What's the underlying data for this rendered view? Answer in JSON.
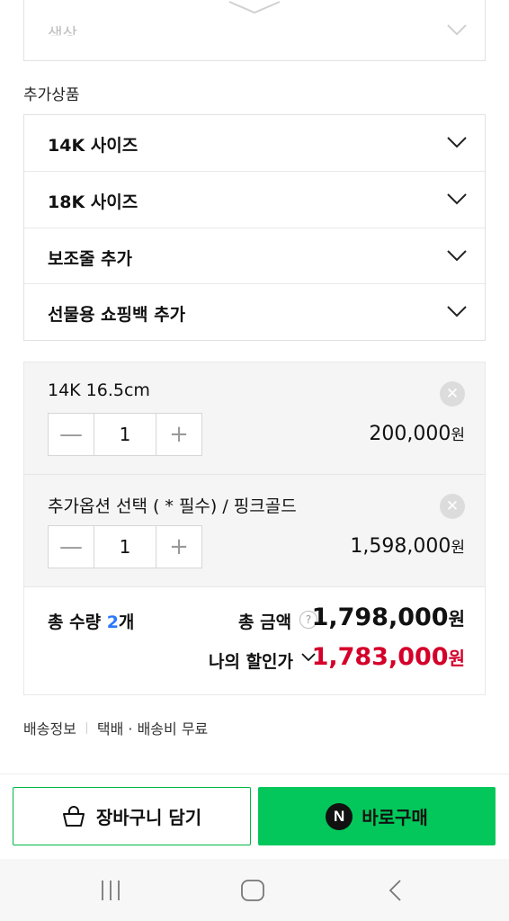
{
  "top_select": {
    "label": "색상",
    "icon": "chevron-down-icon"
  },
  "additional": {
    "label": "추가상품",
    "options": [
      {
        "label": "14K 사이즈"
      },
      {
        "label": "18K 사이즈"
      },
      {
        "label": "보조줄 추가"
      },
      {
        "label": "선물용 쇼핑백 추가"
      }
    ]
  },
  "selected": [
    {
      "name": "14K 16.5cm",
      "qty": "1",
      "price": "200,000",
      "currency": "원",
      "minus": "—",
      "plus": "+",
      "remove": "✕"
    },
    {
      "name": "추가옵션 선택 ( * 필수) / 핑크골드",
      "qty": "1",
      "price": "1,598,000",
      "currency": "원",
      "minus": "—",
      "plus": "+",
      "remove": "✕"
    }
  ],
  "totals": {
    "qty_label": "총 수량",
    "qty_value": "2",
    "qty_unit": "개",
    "amount_label": "총 금액",
    "help": "?",
    "amount": "1,798,000",
    "currency": "원",
    "discount_label": "나의 할인가",
    "discount_amount": "1,783,000",
    "discount_color": "#d4002a",
    "qty_color": "#2b78ff"
  },
  "shipping": {
    "label": "배송정보",
    "value": "택배 · 배송비 무료"
  },
  "buttons": {
    "cart": "장바구니 담기",
    "buy": "바로구매",
    "n_badge": "N",
    "buy_color": "#03c75a"
  },
  "navbar": {
    "icons": [
      "recent-apps-icon",
      "home-icon",
      "back-icon"
    ]
  }
}
